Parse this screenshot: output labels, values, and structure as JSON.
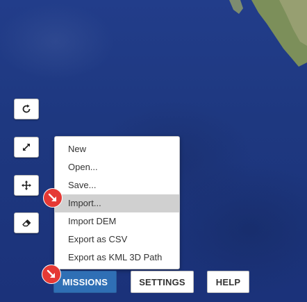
{
  "map": {
    "icon": "satellite-map"
  },
  "toolbar": {
    "buttons": [
      {
        "icon": "refresh-icon"
      },
      {
        "icon": "expand-icon"
      },
      {
        "icon": "move-icon"
      },
      {
        "icon": "eraser-icon"
      }
    ]
  },
  "menu": {
    "items": [
      {
        "label": "New"
      },
      {
        "label": "Open..."
      },
      {
        "label": "Save..."
      },
      {
        "label": "Import..."
      },
      {
        "label": "Import DEM"
      },
      {
        "label": "Export as CSV"
      },
      {
        "label": "Export as KML 3D Path"
      }
    ],
    "highlighted_index": 3
  },
  "bottom_bar": {
    "missions_label": "MISSIONS",
    "settings_label": "SETTINGS",
    "help_label": "HELP"
  },
  "colors": {
    "ocean": "#1e3880",
    "accent": "#2f6fb5",
    "marker": "#e53935",
    "highlight": "#d0d0d0"
  }
}
